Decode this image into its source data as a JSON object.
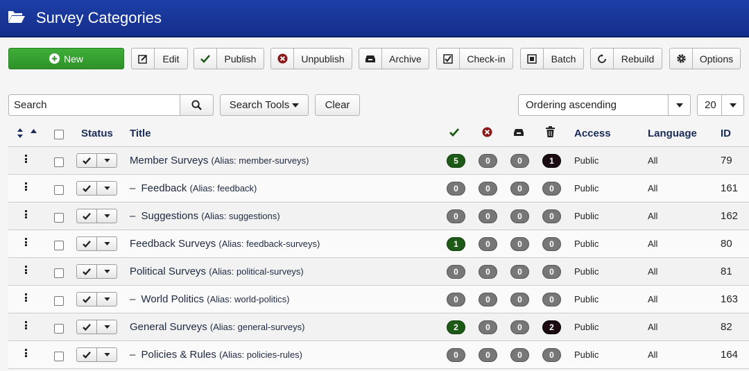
{
  "header": {
    "title": "Survey Categories",
    "icon": "folder-open-icon"
  },
  "toolbar": {
    "new": "New",
    "edit": "Edit",
    "publish": "Publish",
    "unpublish": "Unpublish",
    "archive": "Archive",
    "checkin": "Check-in",
    "batch": "Batch",
    "rebuild": "Rebuild",
    "options": "Options"
  },
  "filters": {
    "search_placeholder": "Search",
    "search_tools": "Search Tools",
    "clear": "Clear",
    "ordering": "Ordering ascending",
    "limit": "20"
  },
  "table": {
    "headers": {
      "status": "Status",
      "title": "Title",
      "access": "Access",
      "language": "Language",
      "id": "ID"
    },
    "rows": [
      {
        "title": "Member Surveys",
        "alias": "(Alias: member-surveys)",
        "child": false,
        "published": "5",
        "unpublished": "0",
        "archived": "0",
        "trashed": "1",
        "access": "Public",
        "language": "All",
        "id": "79"
      },
      {
        "title": "Feedback",
        "alias": "(Alias: feedback)",
        "child": true,
        "published": "0",
        "unpublished": "0",
        "archived": "0",
        "trashed": "0",
        "access": "Public",
        "language": "All",
        "id": "161"
      },
      {
        "title": "Suggestions",
        "alias": "(Alias: suggestions)",
        "child": true,
        "published": "0",
        "unpublished": "0",
        "archived": "0",
        "trashed": "0",
        "access": "Public",
        "language": "All",
        "id": "162"
      },
      {
        "title": "Feedback Surveys",
        "alias": "(Alias: feedback-surveys)",
        "child": false,
        "published": "1",
        "unpublished": "0",
        "archived": "0",
        "trashed": "0",
        "access": "Public",
        "language": "All",
        "id": "80"
      },
      {
        "title": "Political Surveys",
        "alias": "(Alias: political-surveys)",
        "child": false,
        "published": "0",
        "unpublished": "0",
        "archived": "0",
        "trashed": "0",
        "access": "Public",
        "language": "All",
        "id": "81"
      },
      {
        "title": "World Politics",
        "alias": "(Alias: world-politics)",
        "child": true,
        "published": "0",
        "unpublished": "0",
        "archived": "0",
        "trashed": "0",
        "access": "Public",
        "language": "All",
        "id": "163"
      },
      {
        "title": "General Surveys",
        "alias": "(Alias: general-surveys)",
        "child": false,
        "published": "2",
        "unpublished": "0",
        "archived": "0",
        "trashed": "2",
        "access": "Public",
        "language": "All",
        "id": "82"
      },
      {
        "title": "Policies & Rules",
        "alias": "(Alias: policies-rules)",
        "child": true,
        "published": "0",
        "unpublished": "0",
        "archived": "0",
        "trashed": "0",
        "access": "Public",
        "language": "All",
        "id": "164"
      }
    ]
  },
  "colors": {
    "header": "#1d3fa7",
    "new_button": "#3fae3a",
    "published_badge": "#1e5a17",
    "trashed_badge": "#1c0b12",
    "zero_badge": "#777777"
  }
}
